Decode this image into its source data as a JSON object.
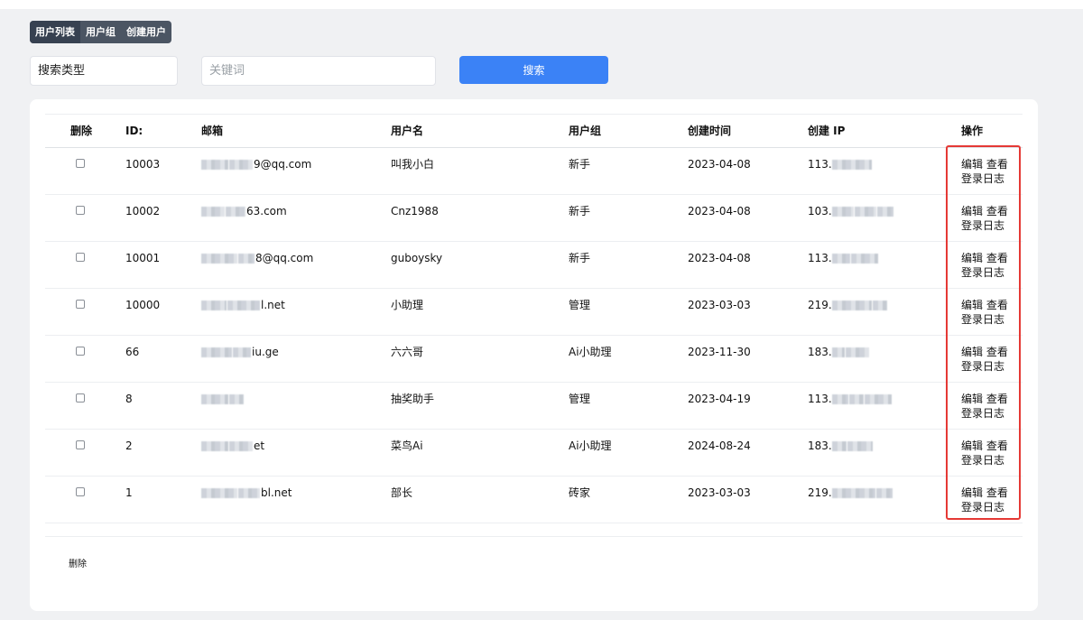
{
  "tabs": [
    {
      "label": "用户列表",
      "active": true
    },
    {
      "label": "用户组",
      "active": false
    },
    {
      "label": "创建用户",
      "active": false
    }
  ],
  "search": {
    "type_label": "搜索类型",
    "keyword_placeholder": "关键词",
    "button_label": "搜索"
  },
  "table": {
    "headers": {
      "delete": "删除",
      "id": "ID:",
      "email": "邮箱",
      "username": "用户名",
      "group": "用户组",
      "created_time": "创建时间",
      "created_ip": "创建 IP",
      "actions": "操作"
    },
    "rows": [
      {
        "id": "10003",
        "email": "9@qq.com",
        "username": "叫我小白",
        "group": "新手",
        "created_time": "2023-04-08",
        "ip": "113."
      },
      {
        "id": "10002",
        "email": "63.com",
        "username": "Cnz1988",
        "group": "新手",
        "created_time": "2023-04-08",
        "ip": "103."
      },
      {
        "id": "10001",
        "email": "8@qq.com",
        "username": "guboysky",
        "group": "新手",
        "created_time": "2023-04-08",
        "ip": "113."
      },
      {
        "id": "10000",
        "email": "l.net",
        "username": "小助理",
        "group": "管理",
        "created_time": "2023-03-03",
        "ip": "219."
      },
      {
        "id": "66",
        "email": "iu.ge",
        "username": "六六哥",
        "group": "Ai小助理",
        "created_time": "2023-11-30",
        "ip": "183."
      },
      {
        "id": "8",
        "email": "",
        "username": "抽奖助手",
        "group": "管理",
        "created_time": "2023-04-19",
        "ip": "113."
      },
      {
        "id": "2",
        "email": "et",
        "username": "菜鸟Ai",
        "group": "Ai小助理",
        "created_time": "2024-08-24",
        "ip": "183."
      },
      {
        "id": "1",
        "email": "bl.net",
        "username": "部长",
        "group": "砖家",
        "created_time": "2023-03-03",
        "ip": "219."
      }
    ],
    "actions": {
      "edit": "编辑",
      "view": "查看",
      "login_log": "登录日志"
    }
  },
  "footer": {
    "delete_label": "删除"
  },
  "colors": {
    "accent": "#3b82f6",
    "highlight_box": "#e53935",
    "tab_bg": "#4b5563",
    "tab_active_bg": "#374151"
  }
}
